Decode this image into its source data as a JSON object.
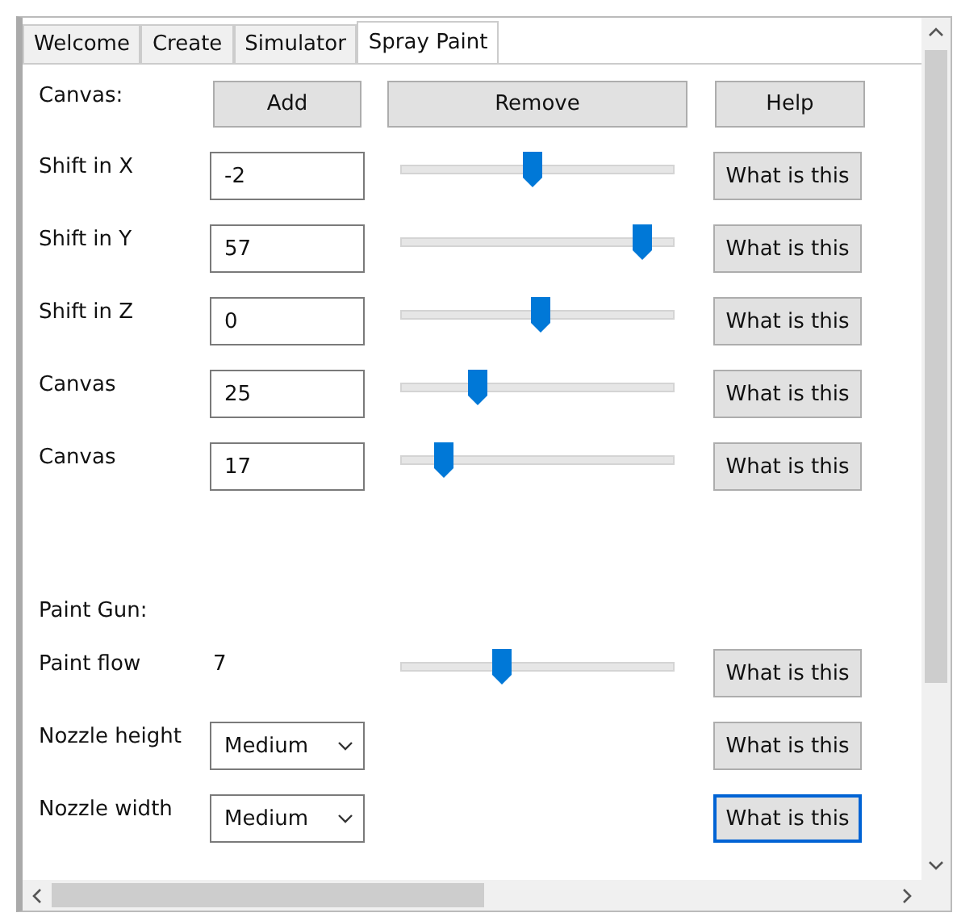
{
  "tabs": [
    {
      "label": "Welcome",
      "selected": false
    },
    {
      "label": "Create",
      "selected": false
    },
    {
      "label": "Simulator",
      "selected": false
    },
    {
      "label": "Spray Paint",
      "selected": true
    }
  ],
  "canvas": {
    "label": "Canvas:",
    "buttons": [
      "Add",
      "Remove",
      "Help"
    ],
    "rows": [
      {
        "kind": "input-slider",
        "label": "Shift in X",
        "value": "-2",
        "level": 0.48,
        "help": {
          "label": "What is this",
          "focused": false
        }
      },
      {
        "kind": "input-slider",
        "label": "Shift in Y",
        "value": "57",
        "level": 0.88,
        "help": {
          "label": "What is this",
          "focused": false
        }
      },
      {
        "kind": "input-slider",
        "label": "Shift in Z",
        "value": "0",
        "level": 0.51,
        "help": {
          "label": "What is this",
          "focused": false
        }
      },
      {
        "kind": "input-slider",
        "label": "Canvas",
        "value": "25",
        "level": 0.28,
        "help": {
          "label": "What is this",
          "focused": false
        }
      },
      {
        "kind": "input-slider",
        "label": "Canvas",
        "value": "17",
        "level": 0.16,
        "help": {
          "label": "What is this",
          "focused": false
        }
      }
    ]
  },
  "paint_gun": {
    "label": "Paint Gun:",
    "rows": [
      {
        "kind": "readout-slider",
        "label": "Paint flow",
        "value": "7",
        "level": 0.37,
        "help": {
          "label": "What is this",
          "focused": false
        }
      },
      {
        "kind": "dropdown",
        "label": "Nozzle height",
        "value": "Medium",
        "help": {
          "label": "What is this",
          "focused": false
        }
      },
      {
        "kind": "dropdown",
        "label": "Nozzle width",
        "value": "Medium",
        "help": {
          "label": "What is this",
          "focused": true
        }
      }
    ]
  }
}
